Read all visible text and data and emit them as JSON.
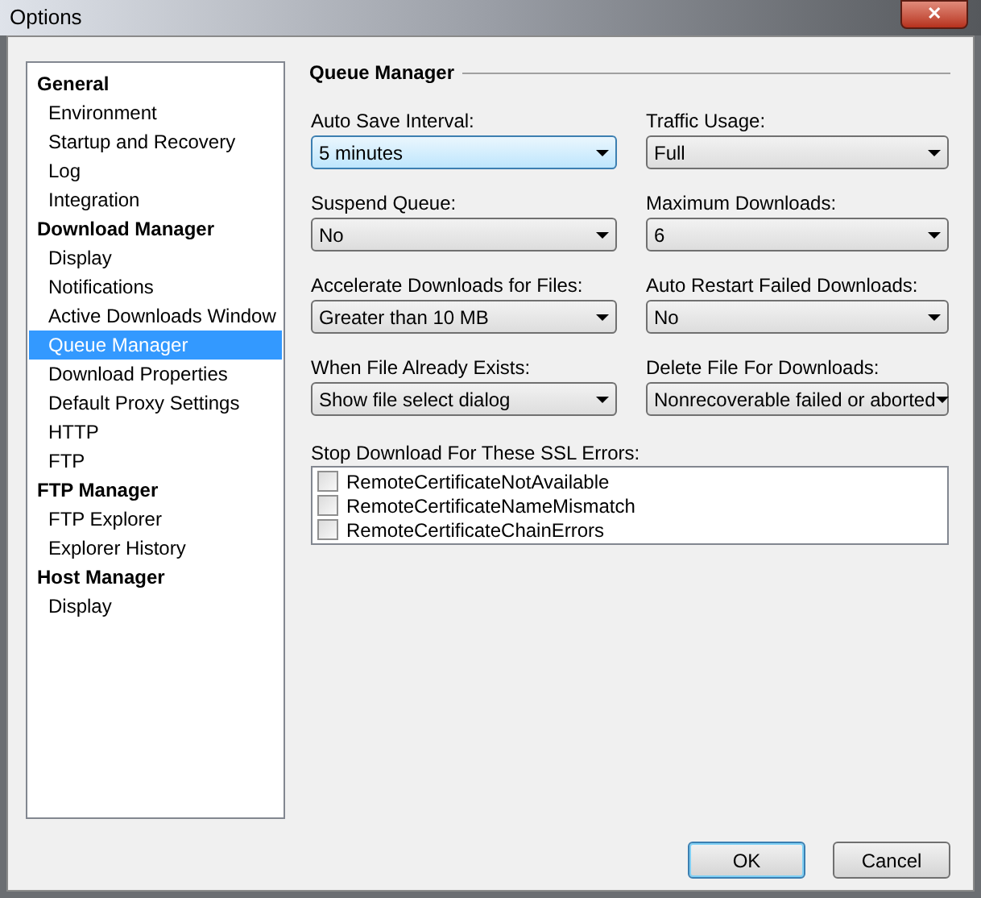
{
  "window": {
    "title": "Options",
    "close_label": "✕"
  },
  "sidebar": {
    "items": [
      {
        "label": "General",
        "selected": false,
        "children": [
          {
            "label": "Environment",
            "selected": false
          },
          {
            "label": "Startup and Recovery",
            "selected": false
          },
          {
            "label": "Log",
            "selected": false
          },
          {
            "label": "Integration",
            "selected": false
          }
        ]
      },
      {
        "label": "Download Manager",
        "selected": false,
        "children": [
          {
            "label": "Display",
            "selected": false
          },
          {
            "label": "Notifications",
            "selected": false
          },
          {
            "label": "Active Downloads Window",
            "selected": false
          },
          {
            "label": "Queue Manager",
            "selected": true
          },
          {
            "label": "Download Properties",
            "selected": false
          },
          {
            "label": "Default Proxy Settings",
            "selected": false
          },
          {
            "label": "HTTP",
            "selected": false
          },
          {
            "label": "FTP",
            "selected": false
          }
        ]
      },
      {
        "label": "FTP Manager",
        "selected": false,
        "children": [
          {
            "label": "FTP Explorer",
            "selected": false
          },
          {
            "label": "Explorer History",
            "selected": false
          }
        ]
      },
      {
        "label": "Host Manager",
        "selected": false,
        "children": [
          {
            "label": "Display",
            "selected": false
          }
        ]
      }
    ]
  },
  "section": {
    "title": "Queue Manager"
  },
  "fields": [
    {
      "label": "Auto Save Interval:",
      "value": "5 minutes",
      "focused": true
    },
    {
      "label": "Traffic Usage:",
      "value": "Full",
      "focused": false
    },
    {
      "label": "Suspend Queue:",
      "value": "No",
      "focused": false
    },
    {
      "label": "Maximum Downloads:",
      "value": "6",
      "focused": false
    },
    {
      "label": "Accelerate Downloads for Files:",
      "value": "Greater than 10 MB",
      "focused": false
    },
    {
      "label": "Auto Restart Failed Downloads:",
      "value": "No",
      "focused": false
    },
    {
      "label": "When File Already Exists:",
      "value": "Show file select dialog",
      "focused": false
    },
    {
      "label": "Delete File For Downloads:",
      "value": "Nonrecoverable failed or aborted",
      "focused": false
    }
  ],
  "ssl_errors": {
    "label": "Stop Download For These SSL Errors:",
    "items": [
      {
        "label": "RemoteCertificateNotAvailable",
        "checked": false
      },
      {
        "label": "RemoteCertificateNameMismatch",
        "checked": false
      },
      {
        "label": "RemoteCertificateChainErrors",
        "checked": false
      }
    ]
  },
  "buttons": [
    {
      "label": "OK",
      "default": true
    },
    {
      "label": "Cancel",
      "default": false
    }
  ]
}
